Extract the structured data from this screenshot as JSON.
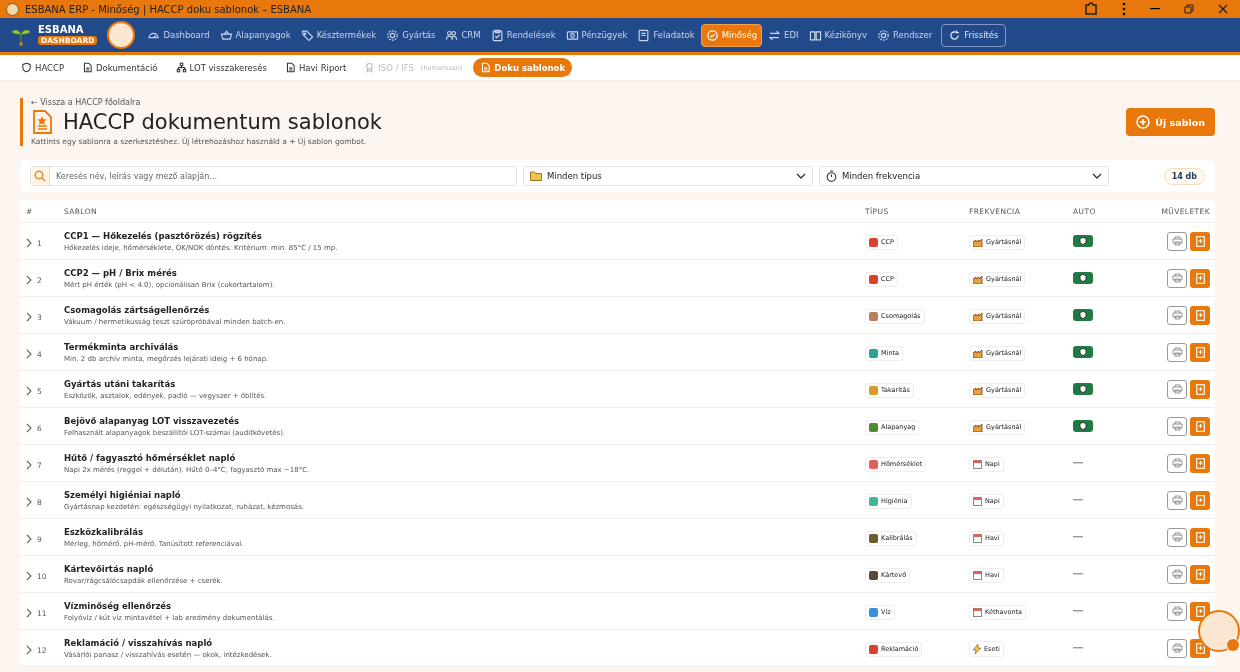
{
  "window": {
    "title": "ESBANA ERP - Minőség | HACCP doku sablonok – ESBANA"
  },
  "brand": {
    "name": "ESBANA",
    "badge": "DASHBOARD"
  },
  "nav": [
    {
      "label": "Dashboard",
      "selected": false
    },
    {
      "label": "Alapanyagok",
      "selected": false
    },
    {
      "label": "Késztermékek",
      "selected": false
    },
    {
      "label": "Gyártás",
      "selected": false
    },
    {
      "label": "CRM",
      "selected": false
    },
    {
      "label": "Rendelések",
      "selected": false
    },
    {
      "label": "Pénzügyek",
      "selected": false
    },
    {
      "label": "Feladatok",
      "selected": false
    },
    {
      "label": "Minőség",
      "selected": true
    },
    {
      "label": "EDI",
      "selected": false
    },
    {
      "label": "Kézikönyv",
      "selected": false
    },
    {
      "label": "Rendszer",
      "selected": false
    }
  ],
  "refresh_button": "Frissítés",
  "subnav": [
    {
      "label": "HACCP",
      "selected": false,
      "disabled": false
    },
    {
      "label": "Dokumentáció",
      "selected": false,
      "disabled": false
    },
    {
      "label": "LOT visszakeresés",
      "selected": false,
      "disabled": false
    },
    {
      "label": "Havi Riport",
      "selected": false,
      "disabled": false
    },
    {
      "label": "ISO / IFS",
      "note": "(hamarosan)",
      "selected": false,
      "disabled": true
    },
    {
      "label": "Doku sablonok",
      "selected": true,
      "disabled": false
    }
  ],
  "back_link": "← Vissza a HACCP főoldalra",
  "title": "HACCP dokumentum sablonok",
  "subtitle": "Kattints egy sablonra a szerkesztéshez. Új létrehozáshoz használd a + Új sablon gombot.",
  "new_button": "Új sablon",
  "search": {
    "placeholder": "Keresés név, leírás vagy mező alapján..."
  },
  "type_filter": "Minden típus",
  "freq_filter": "Minden frekvencia",
  "count": "14 db",
  "table": {
    "columns": [
      "#",
      "SABLON",
      "TÍPUS",
      "FREKVENCIA",
      "AUTO",
      "MŰVELETEK"
    ],
    "rows": [
      {
        "num": "1",
        "name": "CCP1 — Hőkezelés (pasztőrözés) rögzítés",
        "desc": "Hőkezelés ideje, hőmérséklete, OK/NOK döntés. Kritérium: min. 85°C / 15 mp.",
        "type": {
          "label": "CCP",
          "color": "#d9412b"
        },
        "freq": {
          "label": "Gyártásnál",
          "kind": "production"
        },
        "auto": true
      },
      {
        "num": "2",
        "name": "CCP2 — pH / Brix mérés",
        "desc": "Mért pH érték (pH < 4.0), opcionálisan Brix (cukortartalom).",
        "type": {
          "label": "CCP",
          "color": "#d9412b"
        },
        "freq": {
          "label": "Gyártásnál",
          "kind": "production"
        },
        "auto": true
      },
      {
        "num": "3",
        "name": "Csomagolás zártságellenőrzés",
        "desc": "Vákuum / hermetikusság teszt szúrópróbával minden batch-en.",
        "type": {
          "label": "Csomagolás",
          "color": "#b7825a"
        },
        "freq": {
          "label": "Gyártásnál",
          "kind": "production"
        },
        "auto": true
      },
      {
        "num": "4",
        "name": "Termékminta archiválás",
        "desc": "Min. 2 db archív minta, megőrzés lejárati ideig + 6 hónap.",
        "type": {
          "label": "Minta",
          "color": "#2aa39a"
        },
        "freq": {
          "label": "Gyártásnál",
          "kind": "production"
        },
        "auto": true
      },
      {
        "num": "5",
        "name": "Gyártás utáni takarítás",
        "desc": "Eszközök, asztalok, edények, padló — vegyszer + öblítés.",
        "type": {
          "label": "Takarítás",
          "color": "#d99a2b"
        },
        "freq": {
          "label": "Gyártásnál",
          "kind": "production"
        },
        "auto": true
      },
      {
        "num": "6",
        "name": "Bejövő alapanyag LOT visszavezetés",
        "desc": "Felhasznált alapanyagok beszállítói LOT-számai (auditkövetés).",
        "type": {
          "label": "Alapanyag",
          "color": "#4e8a2e"
        },
        "freq": {
          "label": "Gyártásnál",
          "kind": "production"
        },
        "auto": true
      },
      {
        "num": "7",
        "name": "Hűtő / fagyasztó hőmérséklet napló",
        "desc": "Napi 2x mérés (reggel + délután). Hűtő 0–4°C, fagyasztó max −18°C.",
        "type": {
          "label": "Hőmérséklet",
          "color": "#e0605a"
        },
        "freq": {
          "label": "Napi",
          "kind": "calendar"
        },
        "auto": false
      },
      {
        "num": "8",
        "name": "Személyi higiéniai napló",
        "desc": "Gyártásnap kezdetén: egészségügyi nyilatkozat, ruházat, kézmosás.",
        "type": {
          "label": "Higiénia",
          "color": "#3fb59a"
        },
        "freq": {
          "label": "Napi",
          "kind": "calendar"
        },
        "auto": false
      },
      {
        "num": "9",
        "name": "Eszközkalibrálás",
        "desc": "Mérleg, hőmérő, pH-mérő. Tanúsított referenciával.",
        "type": {
          "label": "Kalibrálás",
          "color": "#6b5a2e"
        },
        "freq": {
          "label": "Havi",
          "kind": "calendar"
        },
        "auto": false
      },
      {
        "num": "10",
        "name": "Kártevőirtás napló",
        "desc": "Rovar/rágcsálócsapdák ellenőrzése + cserék.",
        "type": {
          "label": "Kártevő",
          "color": "#5a4a3e"
        },
        "freq": {
          "label": "Havi",
          "kind": "calendar"
        },
        "auto": false
      },
      {
        "num": "11",
        "name": "Vízminőség ellenőrzés",
        "desc": "Folyóvíz / kút víz mintavétel + lab eredmény dokumentálás.",
        "type": {
          "label": "Víz",
          "color": "#3a8fd9"
        },
        "freq": {
          "label": "Kéthavonta",
          "kind": "calendar"
        },
        "auto": false
      },
      {
        "num": "12",
        "name": "Reklamáció / visszahívás napló",
        "desc": "Vásárlói panasz / visszahívás esetén — okok, intézkedések.",
        "type": {
          "label": "Reklamáció",
          "color": "#d9412b"
        },
        "freq": {
          "label": "Eseti",
          "kind": "event"
        },
        "auto": false
      }
    ]
  }
}
